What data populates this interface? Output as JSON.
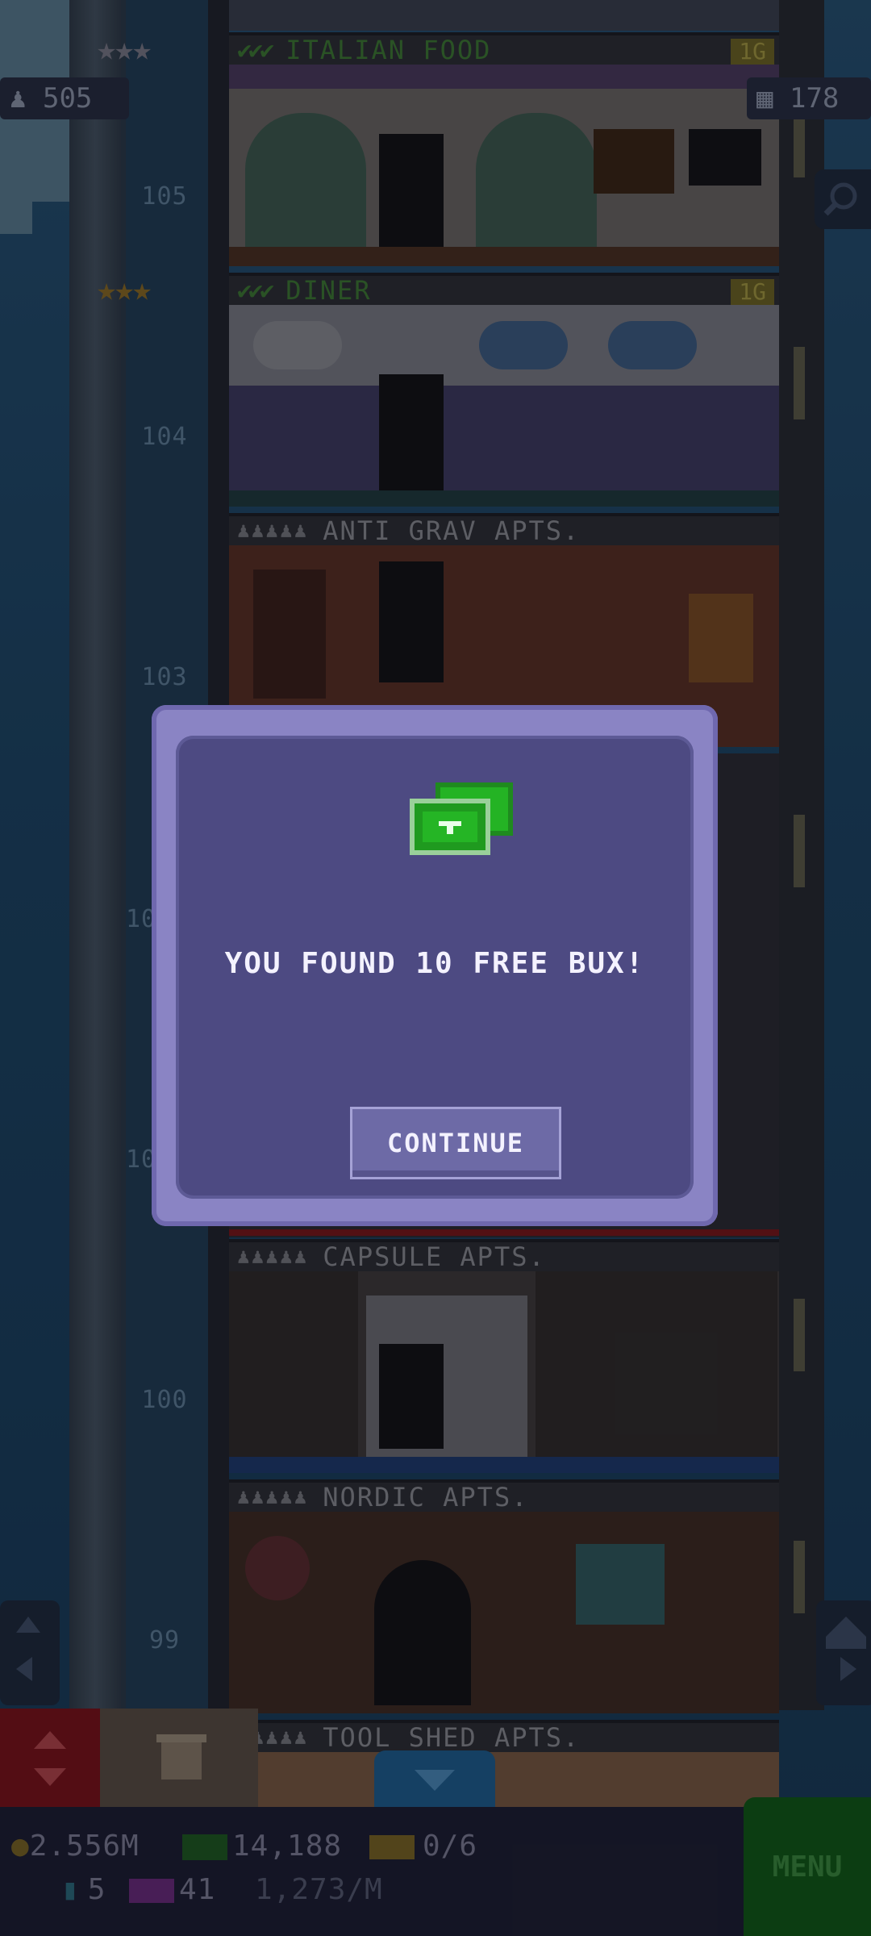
{
  "hud": {
    "population": "505",
    "floors": "178"
  },
  "floors": [
    {
      "title": "ITALIAN FOOD",
      "level": "1G",
      "stars": "★★★",
      "checks": "✔✔✔",
      "number": "105"
    },
    {
      "title": "DINER",
      "level": "1G",
      "stars": "★★★",
      "checks": "✔✔✔",
      "number": "104"
    },
    {
      "title": "ANTI GRAV APTS.",
      "number": "103"
    },
    {
      "title": "CAPSULE APTS.",
      "number": "100"
    },
    {
      "title": "NORDIC APTS.",
      "number": "99"
    },
    {
      "title": "TOOL SHED APTS."
    }
  ],
  "hidden_numbers": [
    "10",
    "10"
  ],
  "dialog": {
    "message": "YOU FOUND 10 FREE BUX!",
    "button": "CONTINUE"
  },
  "bottom": {
    "coins": "2.556M",
    "bux": "14,188",
    "tickets": "0/6",
    "keys": "5",
    "vip": "41",
    "rate": "1,273/M",
    "menu": "MENU"
  },
  "colors": {
    "dialog_bg": "#4d4a82",
    "dialog_border": "#8a84c4",
    "bux_green": "#22b322"
  },
  "icons": [
    "population-icon",
    "floors-icon",
    "search-icon",
    "bux-icon",
    "coin-icon",
    "ticket-icon",
    "key-icon",
    "vip-icon",
    "elevator-icon",
    "storage-icon",
    "down-arrow-icon",
    "home-icon",
    "plane-icon"
  ]
}
